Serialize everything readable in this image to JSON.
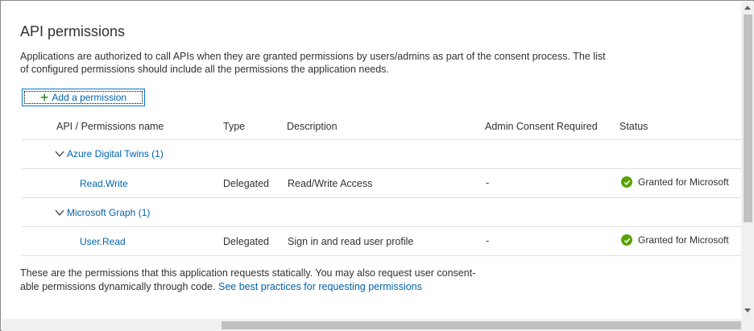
{
  "page": {
    "title": "API permissions",
    "intro_line1": "Applications are authorized to call APIs when they are granted permissions by users/admins as part of the consent process. The list",
    "intro_line2": "of configured permissions should include all the permissions the application needs.",
    "add_permission_label": "Add a permission"
  },
  "table": {
    "columns": [
      "API / Permissions name",
      "Type",
      "Description",
      "Admin Consent Required",
      "Status"
    ],
    "groups": [
      {
        "name": "Azure Digital Twins (1)",
        "rows": [
          {
            "name": "Read.Write",
            "type": "Delegated",
            "description": "Read/Write Access",
            "admin_consent": "-",
            "status": "Granted for Microsoft"
          }
        ]
      },
      {
        "name": "Microsoft Graph (1)",
        "rows": [
          {
            "name": "User.Read",
            "type": "Delegated",
            "description": "Sign in and read user profile",
            "admin_consent": "-",
            "status": "Granted for Microsoft"
          }
        ]
      }
    ]
  },
  "footer": {
    "line1": "These are the permissions that this application requests statically. You may also request user consent-",
    "line2": "able permissions dynamically through code.",
    "link": "See best practices for requesting permissions"
  },
  "colors": {
    "link": "#0062ad",
    "granted": "#57a300",
    "add_icon": "#107c10"
  },
  "icons": {
    "add": "plus-icon",
    "expand": "chevron-down-icon",
    "granted": "checkmark-circle-icon"
  }
}
